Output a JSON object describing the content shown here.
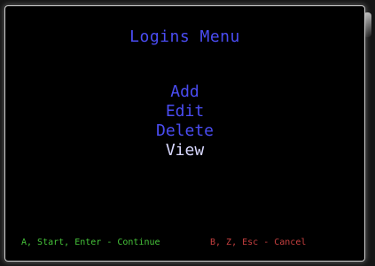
{
  "screen": {
    "title": "Logins Menu",
    "menu_items": [
      {
        "label": "Add",
        "selected": false
      },
      {
        "label": "Edit",
        "selected": false
      },
      {
        "label": "Delete",
        "selected": false
      },
      {
        "label": "View",
        "selected": true
      }
    ],
    "footer": {
      "continue_hint": "A, Start, Enter - Continue",
      "cancel_hint": "B, Z, Esc - Cancel"
    }
  },
  "colors": {
    "background": "#000000",
    "menu_text": "#4a4cf2",
    "selected_text": "#d8d8ff",
    "continue_hint": "#46c43a",
    "cancel_hint": "#c84040"
  }
}
